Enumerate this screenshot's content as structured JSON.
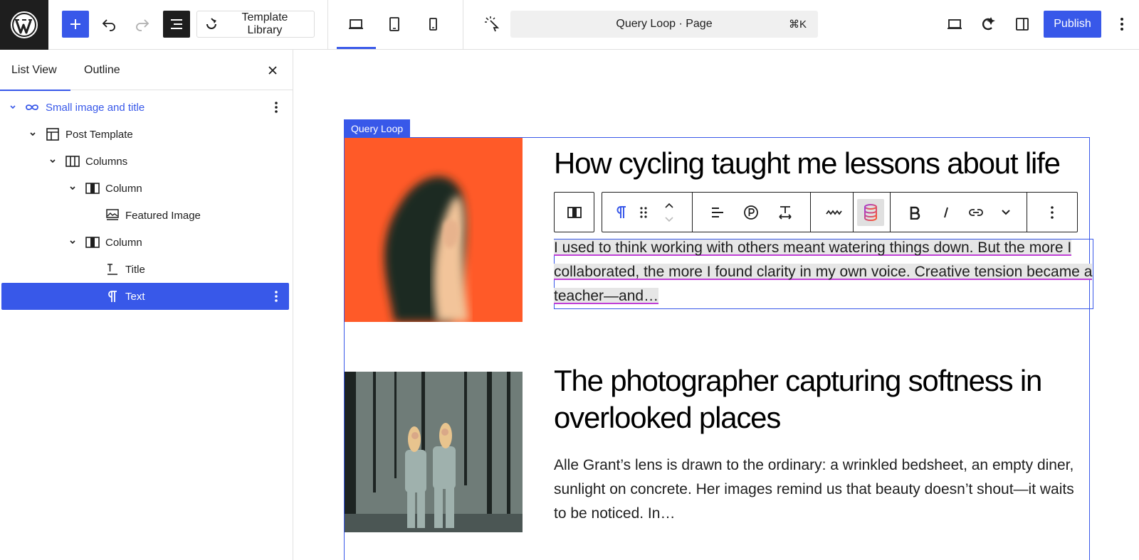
{
  "toolbar": {
    "template_library_label": "Template Library",
    "command_bar_title": "Query Loop · Page",
    "command_shortcut": "⌘K",
    "publish_label": "Publish"
  },
  "sidebar": {
    "tabs": [
      {
        "label": "List View",
        "active": true
      },
      {
        "label": "Outline",
        "active": false
      }
    ],
    "tree": [
      {
        "label": "Small image and title",
        "icon": "loop-icon",
        "level": 0,
        "expanded": true,
        "selected": false
      },
      {
        "label": "Post Template",
        "icon": "layout-icon",
        "level": 1,
        "expanded": true,
        "selected": false
      },
      {
        "label": "Columns",
        "icon": "columns-icon",
        "level": 2,
        "expanded": true,
        "selected": false
      },
      {
        "label": "Column",
        "icon": "column-icon",
        "level": 3,
        "expanded": true,
        "selected": false
      },
      {
        "label": "Featured Image",
        "icon": "featured-image-icon",
        "level": 4,
        "expanded": false,
        "selected": false
      },
      {
        "label": "Column",
        "icon": "column-icon",
        "level": 3,
        "expanded": true,
        "selected": false
      },
      {
        "label": "Title",
        "icon": "title-icon",
        "level": 4,
        "expanded": false,
        "selected": false
      },
      {
        "label": "Text",
        "icon": "paragraph-icon",
        "level": 4,
        "expanded": false,
        "selected": true
      }
    ]
  },
  "canvas": {
    "block_label": "Query Loop",
    "posts": [
      {
        "title": "How cycling taught me lessons about life and balance",
        "excerpt": "I used to think working with others meant watering things down. But the more I collaborated, the more I found clarity in my own voice. Creative tension became a teacher—and…"
      },
      {
        "title": "The photographer capturing softness in overlooked places",
        "excerpt": "Alle Grant’s lens is drawn to the ordinary: a wrinkled bedsheet, an empty diner, sunlight on concrete. Her images remind us that beauty doesn’t shout—it waits to be noticed. In…"
      }
    ]
  },
  "colors": {
    "accent": "#3858e9",
    "dark": "#1e1e1e",
    "image1_background": "#ff5a28"
  }
}
